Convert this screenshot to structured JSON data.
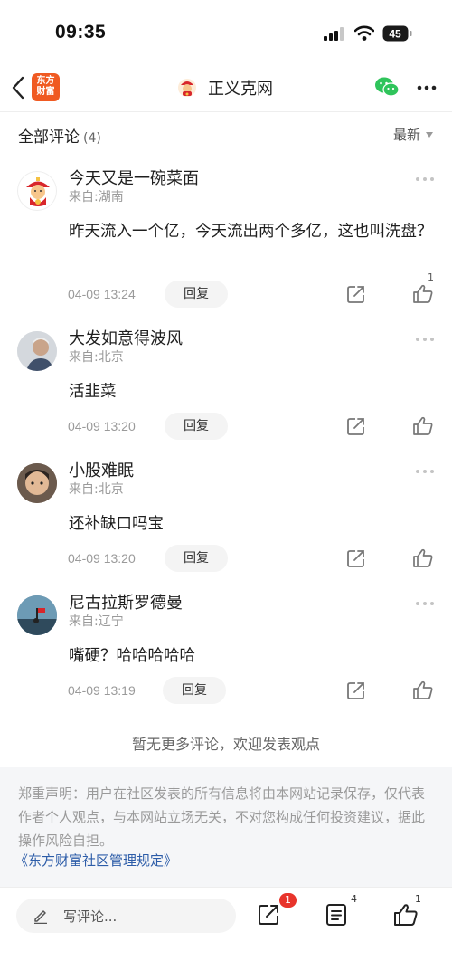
{
  "status_bar": {
    "time": "09:35",
    "battery": "45"
  },
  "nav": {
    "logo_line1": "东方",
    "logo_line2": "财富",
    "channel_name": "正义克网",
    "icons": [
      "back-icon",
      "wechat-icon",
      "more-icon"
    ]
  },
  "section": {
    "title": "全部评论",
    "count": "(4)",
    "sort_label": "最新"
  },
  "comments": [
    {
      "username": "今天又是一碗菜面",
      "location": "来自:湖南",
      "text": "昨天流入一个亿，今天流出两个多亿，这也叫洗盘？",
      "date": "04-09 13:24",
      "reply_label": "回复",
      "like_count": "1"
    },
    {
      "username": "大发如意得波风",
      "location": "来自:北京",
      "text": "活韭菜",
      "date": "04-09 13:20",
      "reply_label": "回复",
      "like_count": ""
    },
    {
      "username": "小股难眠",
      "location": "来自:北京",
      "text": "还补缺口吗宝",
      "date": "04-09 13:20",
      "reply_label": "回复",
      "like_count": ""
    },
    {
      "username": "尼古拉斯罗德曼",
      "location": "来自:辽宁",
      "text": "嘴硬？哈哈哈哈哈",
      "date": "04-09 13:19",
      "reply_label": "回复",
      "like_count": ""
    }
  ],
  "no_more": "暂无更多评论，欢迎发表观点",
  "disclaimer": {
    "text": "郑重声明：用户在社区发表的所有信息将由本网站记录保存，仅代表作者个人观点，与本网站立场无关，不对您构成任何投资建议，据此操作风险自担。",
    "link": "《东方财富社区管理规定》"
  },
  "bottom_bar": {
    "write_placeholder": "写评论...",
    "share_badge": "1",
    "comments_count": "4",
    "likes_count": "1"
  },
  "colors": {
    "accent": "#f05a22",
    "link": "#2c5ca8",
    "badge": "#e8342b",
    "wechat": "#2fc45b"
  }
}
